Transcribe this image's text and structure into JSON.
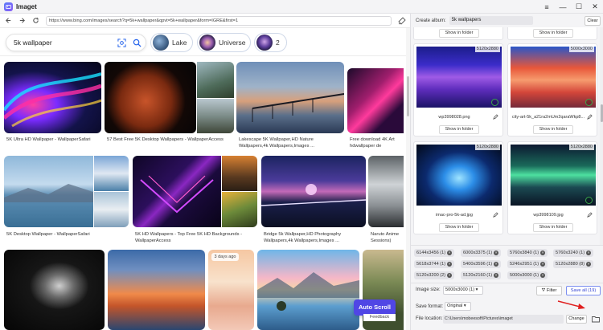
{
  "window": {
    "title": "Imaget"
  },
  "browser": {
    "url": "https://www.bing.com/images/search?q=5k+wallpaper&qpvt=5k+wallpaper&form=IGRE&first=1"
  },
  "search": {
    "query": "5k wallpaper",
    "chips": [
      {
        "label": "Lake"
      },
      {
        "label": "Universe"
      },
      {
        "label": "2"
      }
    ]
  },
  "gallery": {
    "captions": [
      "5K Ultra HD Wallpaper - WallpaperSafari",
      "57 Best Free 5K Desktop Wallpapers - WallpaperAccess",
      "Lakescape 5K Wallpaper,HD Nature Wallpapers,4k Wallpapers,Images ...",
      "Free download 4K Art hdwallpaper de",
      "5K Desktop Wallpaper - WallpaperSafari",
      "5K HD Wallpapers - Top Free 5K HD Backgrounds - WallpaperAccess",
      "Bridge 5k Wallpaper,HD Photography Wallpapers,4k Wallpapers,Images ...",
      "Naruto Anime Sessions)"
    ],
    "badge": "3 days ago",
    "auto_scroll": "Auto Scroll",
    "feedback": "Feedback"
  },
  "panel": {
    "album_label": "Create album:",
    "album_value": "5k wallpapers",
    "clear": "Clear",
    "show_in_folder": "Show in folder",
    "cards": [
      {
        "dim": "5120x2880",
        "name": "wp3998028.png"
      },
      {
        "dim": "5000x3000",
        "name": "city-art-5k_a21ra2mUm2qaraWkp8..."
      },
      {
        "dim": "5120x2880",
        "name": "imac-pro-5k-ad.jpg"
      },
      {
        "dim": "5120x2880",
        "name": "wp3998109.jpg"
      }
    ],
    "sizes": [
      "6144x3456 (1)",
      "6000x3375 (1)",
      "5760x3840 (1)",
      "5760x3240 (1)",
      "5618x3744 (1)",
      "5400x3596 (1)",
      "5246x2951 (1)",
      "5120x2880 (8)",
      "5120x3200 (2)",
      "5120x2160 (1)",
      "5000x3000 (1)"
    ],
    "image_size_label": "Image size:",
    "image_size_value": "5000x3000 (1)",
    "filter": "Filter",
    "save_all": "Save all (19)",
    "save_format_label": "Save format:",
    "save_format_value": "Original",
    "file_location_label": "File location:",
    "file_location_value": "C:\\Users\\mobeesoft\\Pictures\\imaget",
    "change": "Change"
  }
}
